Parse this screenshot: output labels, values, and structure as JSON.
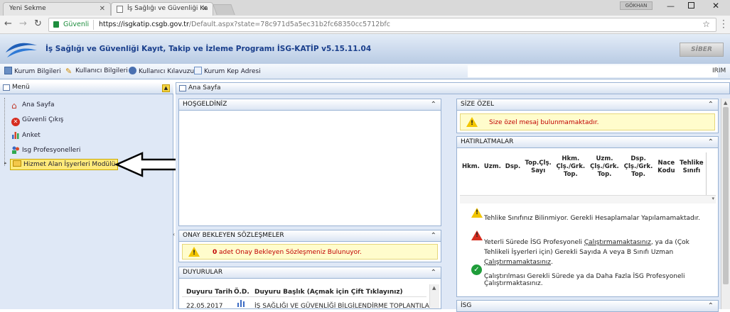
{
  "browser": {
    "tabs": [
      {
        "label": "Yeni Sekme"
      },
      {
        "label": "İş Sağlığı ve Güvenliği Ka"
      }
    ],
    "user": "GÖKHAN",
    "secure_label": "Güvenli",
    "url_host": "https://isgkatip.csgb.gov.tr",
    "url_path": "/Default.aspx?state=78c971d5a5ec31b2fc68350cc5712bfc"
  },
  "app": {
    "title": "İş Sağlığı ve Güvenliği Kayıt, Takip ve İzleme Programı İSG-KATİP v5.15.11.04",
    "partner_logo": "SİBER"
  },
  "toolbar": {
    "items": [
      {
        "label": "Kurum Bilgileri"
      },
      {
        "label": "Kullanıcı Bilgileri"
      },
      {
        "label": "Kullanıcı Kılavuzu"
      },
      {
        "label": "Kurum Kep Adresi"
      }
    ],
    "right_text": "IRIM"
  },
  "menu": {
    "title": "Menü",
    "items": [
      {
        "label": "Ana Sayfa"
      },
      {
        "label": "Güvenli Çıkış"
      },
      {
        "label": "Anket"
      },
      {
        "label": "Isg Profesyonelleri"
      },
      {
        "label": "Hizmet Alan İşyerleri Modülü"
      }
    ]
  },
  "main": {
    "tab_label": "Ana Sayfa",
    "welcome": {
      "title": "HOŞGELDİNİZ"
    },
    "pending": {
      "title": "ONAY BEKLEYEN SÖZLEŞMELER",
      "count": "0",
      "message": "adet Onay Bekleyen Sözleşmeniz Bulunuyor."
    },
    "announcements": {
      "title": "DUYURULAR",
      "headers": [
        "Duyuru Tarih",
        "Ö.D.",
        "Duyuru Başlık (Açmak için Çift Tıklayınız)"
      ],
      "rows": [
        {
          "date": "22.05.2017",
          "title": "İŞ SAĞLIĞI VE GÜVENLİĞİ BİLGİLENDİRME TOPLANTILARI"
        }
      ]
    },
    "personal": {
      "title": "SİZE ÖZEL",
      "message": "Size özel mesaj bulunmamaktadır."
    },
    "reminders": {
      "title": "HATIRLATMALAR",
      "headers": [
        "Hkm.",
        "Uzm.",
        "Dsp.",
        "Top.Çlş. Sayı",
        "Hkm. Çlş./Grk. Top.",
        "Uzm. Çlş./Grk. Top.",
        "Dsp. Çlş./Grk. Top.",
        "Nace Kodu",
        "Tehlike Sınıfı"
      ],
      "notes": [
        {
          "prefix": "Tehlike Sınıfınız Bilinmiyor. Gerekli Hesaplamalar Yapılamamaktadır."
        },
        {
          "prefix": "Yeterli Sürede İSG Profesyoneli ",
          "link1": "Çalıştırmamaktasınız",
          "middle": ", ya da (Çok Tehlikeli İşyerleri için) Gerekli Sayıda A veya B Sınıfı Uzman ",
          "link2": "Çalıştırmamaktasınız",
          "suffix": "."
        },
        {
          "prefix": "Çalıştırılması Gerekli Sürede ya da Daha Fazla İSG Profesyoneli Çalıştırmaktasınız."
        }
      ]
    },
    "isg": {
      "title": "İSG"
    }
  },
  "colors": {
    "accent": "#1a3f8c",
    "warning_text": "#c00000",
    "menu_bg": "#dfe8f6",
    "highlight": "#ffe97a"
  }
}
